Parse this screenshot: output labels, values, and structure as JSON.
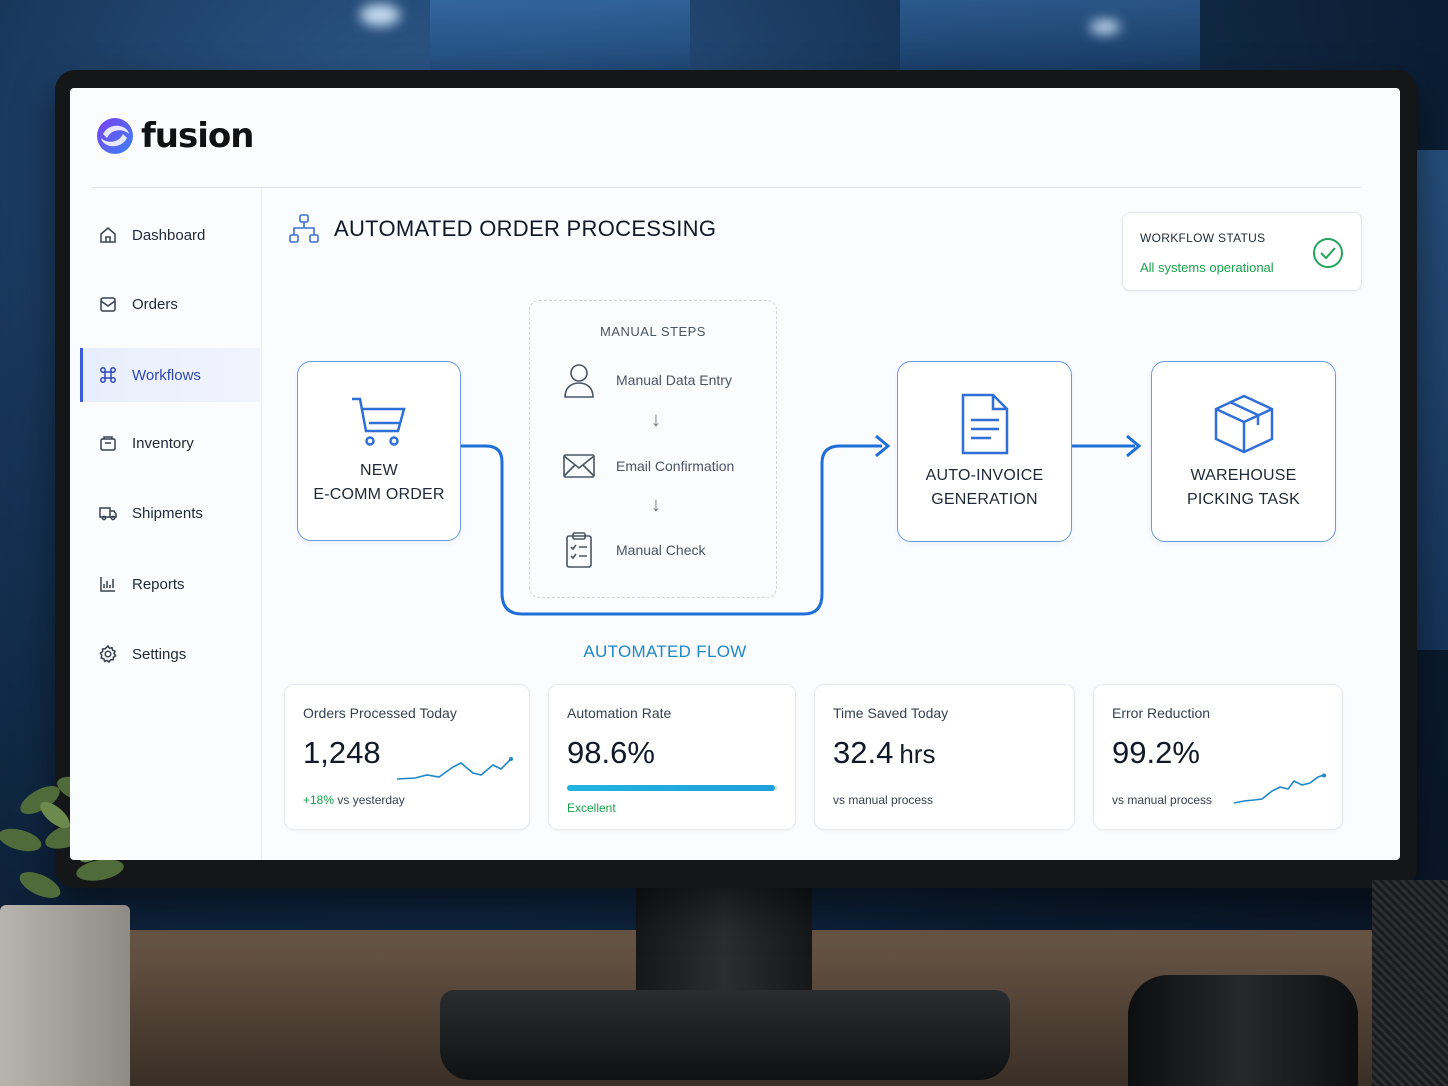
{
  "brand": {
    "name": "fusion"
  },
  "sidebar": {
    "items": [
      {
        "label": "Dashboard",
        "icon": "home-icon"
      },
      {
        "label": "Orders",
        "icon": "mail-tray-icon"
      },
      {
        "label": "Workflows",
        "icon": "command-icon",
        "active": true
      },
      {
        "label": "Inventory",
        "icon": "box-icon"
      },
      {
        "label": "Shipments",
        "icon": "truck-icon"
      },
      {
        "label": "Reports",
        "icon": "chart-icon"
      },
      {
        "label": "Settings",
        "icon": "gear-icon"
      }
    ]
  },
  "page": {
    "title": "AUTOMATED ORDER PROCESSING"
  },
  "status": {
    "label": "WORKFLOW STATUS",
    "value": "All systems operational"
  },
  "flow": {
    "start": "NEW\nE-COMM ORDER",
    "invoice": "AUTO-INVOICE\nGENERATION",
    "warehouse": "WAREHOUSE\nPICKING TASK",
    "automated_label": "AUTOMATED FLOW",
    "manual": {
      "title": "MANUAL STEPS",
      "steps": [
        "Manual Data Entry",
        "Email Confirmation",
        "Manual Check"
      ]
    }
  },
  "kpis": {
    "orders": {
      "title": "Orders Processed Today",
      "value": "1,248",
      "delta": "+18%",
      "sub": "vs yesterday"
    },
    "automation": {
      "title": "Automation Rate",
      "value": "98.6%",
      "progress": 0.986,
      "rating": "Excellent"
    },
    "time": {
      "title": "Time Saved Today",
      "value": "32.4",
      "unit": "hrs",
      "sub": "vs manual process"
    },
    "errors": {
      "title": "Error Reduction",
      "value": "99.2%",
      "sub": "vs manual process"
    }
  },
  "colors": {
    "accent": "#3b5bdb",
    "flow": "#1e6fd9",
    "success": "#16a34a",
    "progress": "#22b4e0"
  }
}
